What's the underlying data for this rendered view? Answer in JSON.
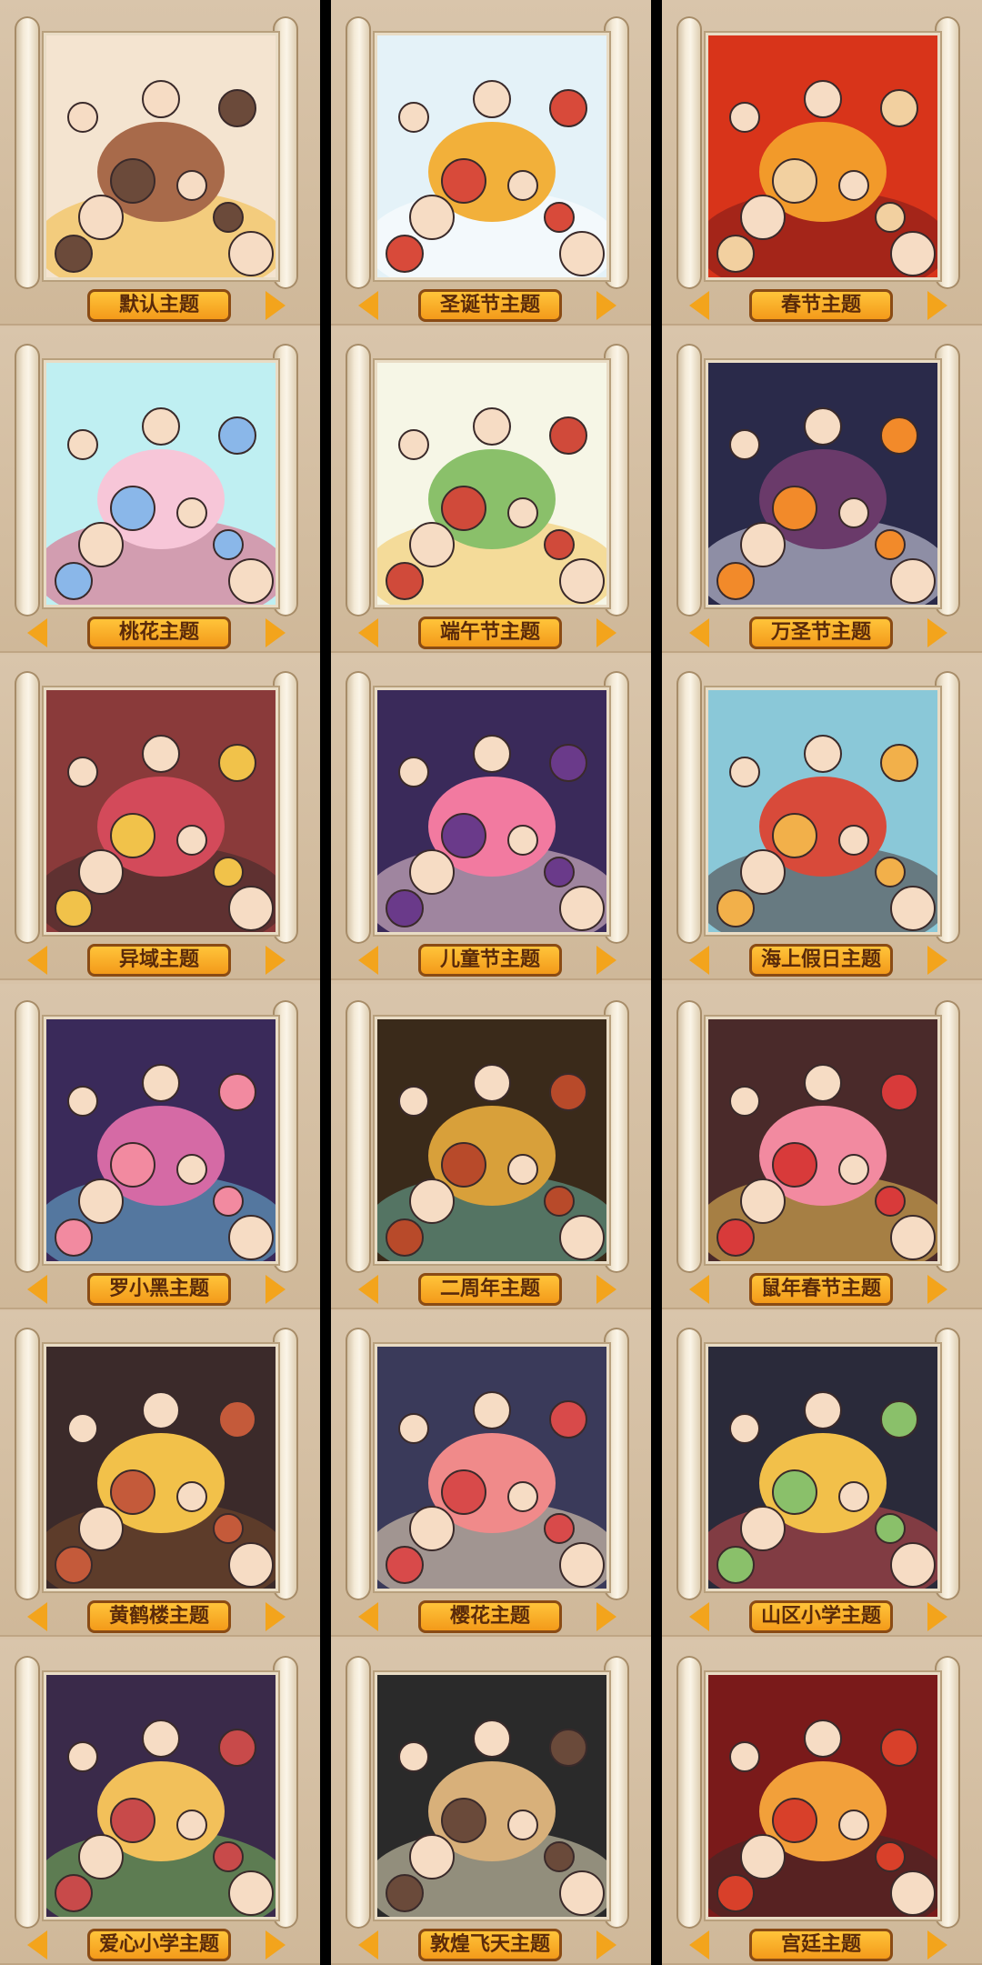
{
  "columns": [
    {
      "cards": [
        {
          "label": "默认主题",
          "palette": [
            "#f4e4d0",
            "#a86a4a",
            "#6b4a3a",
            "#f2b838"
          ],
          "show_left": false
        },
        {
          "label": "桃花主题",
          "palette": [
            "#bfeff2",
            "#f7c6d8",
            "#8ab7e9",
            "#e25a7a"
          ],
          "show_left": true
        },
        {
          "label": "异域主题",
          "palette": [
            "#8a3a3a",
            "#d34a5a",
            "#f1c24a",
            "#3c2a2a"
          ],
          "show_left": true
        },
        {
          "label": "罗小黑主题",
          "palette": [
            "#3a2a5a",
            "#d56aa5",
            "#f28aa0",
            "#6ab7d8"
          ],
          "show_left": true
        },
        {
          "label": "黄鹤楼主题",
          "palette": [
            "#3b2a2a",
            "#f2c14a",
            "#c45a3a",
            "#7a4a2a"
          ],
          "show_left": true
        },
        {
          "label": "爱心小学主题",
          "palette": [
            "#3a2a4a",
            "#f2c05a",
            "#c84a4a",
            "#7ac05a"
          ],
          "show_left": true
        }
      ]
    },
    {
      "cards": [
        {
          "label": "圣诞节主题",
          "palette": [
            "#e4f2f8",
            "#f2b03a",
            "#d84a3a",
            "#ffffff"
          ],
          "show_left": true
        },
        {
          "label": "端午节主题",
          "palette": [
            "#f6f6e6",
            "#8ac06a",
            "#d04a3a",
            "#f2c45a"
          ],
          "show_left": true
        },
        {
          "label": "儿童节主题",
          "palette": [
            "#3a2a5a",
            "#f27aa0",
            "#6a3a8a",
            "#f2d0d8"
          ],
          "show_left": true
        },
        {
          "label": "二周年主题",
          "palette": [
            "#3a2a1a",
            "#d8a03a",
            "#b84a2a",
            "#6ab0a0"
          ],
          "show_left": true
        },
        {
          "label": "樱花主题",
          "palette": [
            "#3a3a5a",
            "#f08a8a",
            "#d84a4a",
            "#f6e0c0"
          ],
          "show_left": true
        },
        {
          "label": "敦煌飞天主题",
          "palette": [
            "#2a2a2a",
            "#d8b07a",
            "#6a4a3a",
            "#e8e0c0"
          ],
          "show_left": true
        }
      ]
    },
    {
      "cards": [
        {
          "label": "春节主题",
          "palette": [
            "#d8341a",
            "#f29a2a",
            "#f2d0a0",
            "#7a1a1a"
          ],
          "show_left": true
        },
        {
          "label": "万圣节主题",
          "palette": [
            "#2a2a4a",
            "#6a3a6a",
            "#f28a2a",
            "#e0e0f0"
          ],
          "show_left": true
        },
        {
          "label": "海上假日主题",
          "palette": [
            "#8ac8d8",
            "#d84a3a",
            "#f2b04a",
            "#4a3a3a"
          ],
          "show_left": true
        },
        {
          "label": "鼠年春节主题",
          "palette": [
            "#4a2a2a",
            "#f28aa0",
            "#d83a3a",
            "#f2c45a"
          ],
          "show_left": true
        },
        {
          "label": "山区小学主题",
          "palette": [
            "#2a2a3a",
            "#f2c04a",
            "#8ac06a",
            "#c84a4a"
          ],
          "show_left": true
        },
        {
          "label": "宫廷主题",
          "palette": [
            "#7a1a1a",
            "#f2a03a",
            "#d8402a",
            "#3a2a2a"
          ],
          "show_left": true
        }
      ]
    }
  ]
}
